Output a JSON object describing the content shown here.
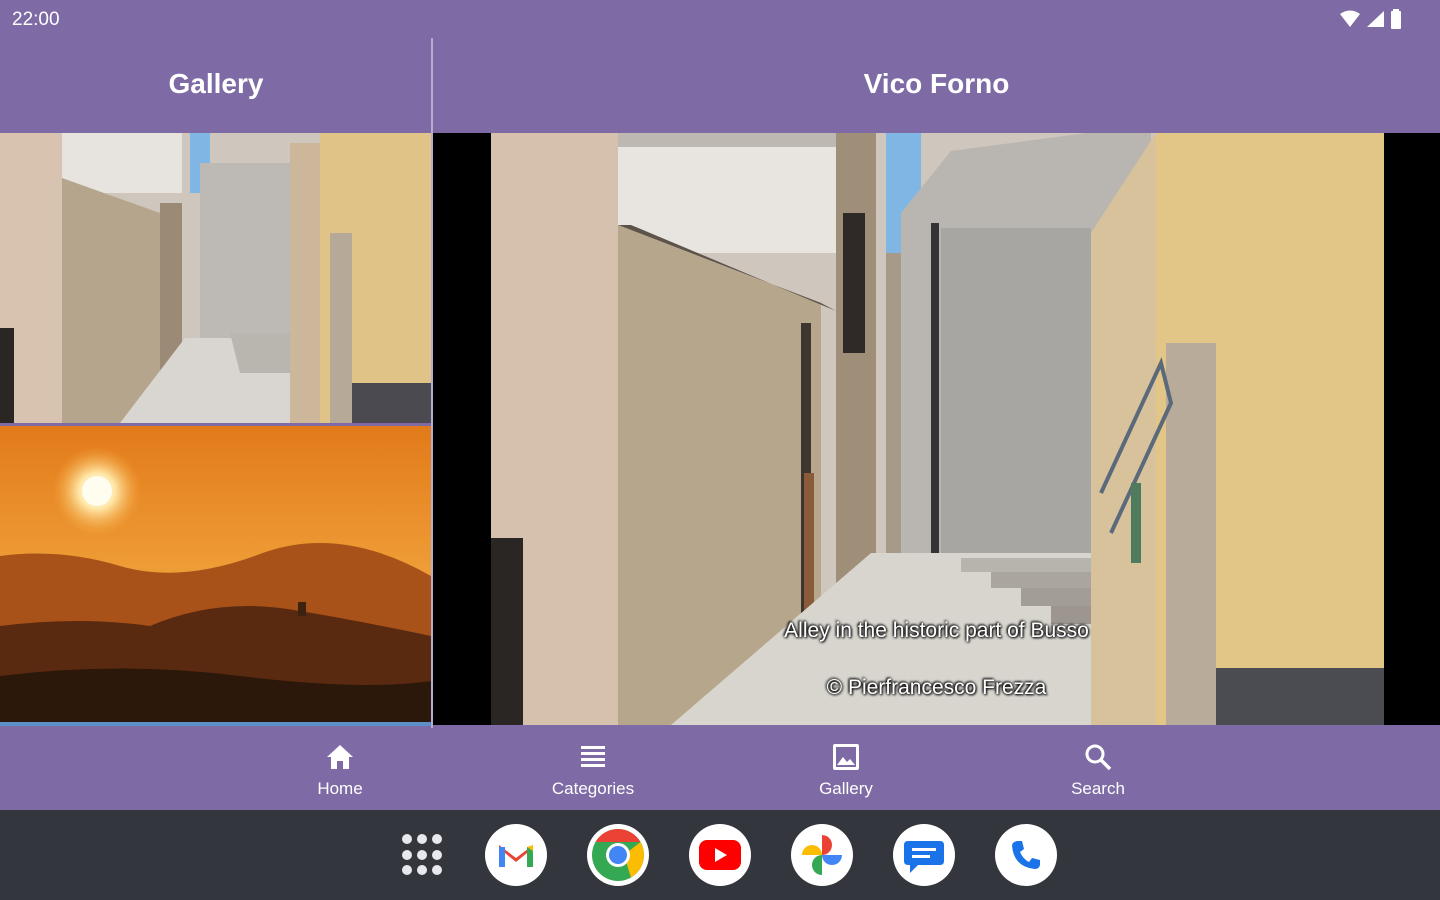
{
  "status_bar": {
    "time": "22:00",
    "icons": [
      "wifi-icon",
      "cell-signal-icon",
      "battery-icon"
    ]
  },
  "left_pane": {
    "title": "Gallery",
    "thumbnails": [
      "alley-photo",
      "sunset-photo"
    ]
  },
  "right_pane": {
    "title": "Vico Forno",
    "caption": "Alley in the historic part of Busso",
    "credit": "© Pierfrancesco Frezza"
  },
  "bottom_nav": {
    "items": [
      {
        "label": "Home",
        "icon": "home-icon"
      },
      {
        "label": "Categories",
        "icon": "list-icon"
      },
      {
        "label": "Gallery",
        "icon": "image-icon",
        "selected": true
      },
      {
        "label": "Search",
        "icon": "search-icon"
      }
    ]
  },
  "dock": {
    "apps": [
      "apps-grid-icon",
      "gmail-icon",
      "chrome-icon",
      "youtube-icon",
      "photos-icon",
      "messages-icon",
      "phone-icon"
    ]
  },
  "colors": {
    "primary": "#7e6ba5",
    "dock": "#34363d"
  }
}
